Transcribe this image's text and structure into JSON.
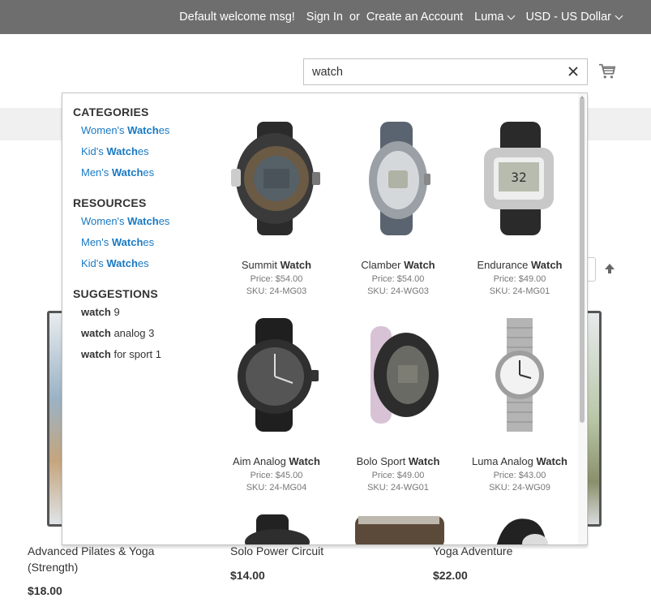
{
  "topbar": {
    "welcome": "Default welcome msg!",
    "sign_in": "Sign In",
    "or": "or",
    "create_account": "Create an Account",
    "store": "Luma",
    "currency": "USD - US Dollar"
  },
  "search": {
    "value": "watch"
  },
  "autocomplete": {
    "categories_title": "CATEGORIES",
    "categories": [
      {
        "prefix": "Women's ",
        "match": "Watch",
        "suffix": "es"
      },
      {
        "prefix": "Kid's ",
        "match": "Watch",
        "suffix": "es"
      },
      {
        "prefix": "Men's ",
        "match": "Watch",
        "suffix": "es"
      }
    ],
    "resources_title": "RESOURCES",
    "resources": [
      {
        "prefix": "Women's ",
        "match": "Watch",
        "suffix": "es"
      },
      {
        "prefix": "Men's ",
        "match": "Watch",
        "suffix": "es"
      },
      {
        "prefix": "Kid's ",
        "match": "Watch",
        "suffix": "es"
      }
    ],
    "suggestions_title": "SUGGESTIONS",
    "suggestions": [
      {
        "match": "watch",
        "rest": " 9"
      },
      {
        "match": "watch",
        "rest": " analog 3"
      },
      {
        "match": "watch",
        "rest": " for sport 1"
      }
    ],
    "products": [
      {
        "name": "Summit ",
        "match": "Watch",
        "price": "Price: $54.00",
        "sku": "SKU: 24-MG03"
      },
      {
        "name": "Clamber ",
        "match": "Watch",
        "price": "Price: $54.00",
        "sku": "SKU: 24-WG03"
      },
      {
        "name": "Endurance ",
        "match": "Watch",
        "price": "Price: $49.00",
        "sku": "SKU: 24-MG01"
      },
      {
        "name": "Aim Analog ",
        "match": "Watch",
        "price": "Price: $45.00",
        "sku": "SKU: 24-MG04"
      },
      {
        "name": "Bolo Sport ",
        "match": "Watch",
        "price": "Price: $49.00",
        "sku": "SKU: 24-WG01"
      },
      {
        "name": "Luma Analog ",
        "match": "Watch",
        "price": "Price: $43.00",
        "sku": "SKU: 24-WG09"
      }
    ]
  },
  "background_products": [
    {
      "name_line1": "Advanced Pilates & Yoga",
      "name_line2": "(Strength)",
      "price": "$18.00"
    },
    {
      "name_line1": "Solo Power Circuit",
      "name_line2": "",
      "price": "$14.00"
    },
    {
      "name_line1": "Yoga Adventure",
      "name_line2": "",
      "price": "$22.00"
    }
  ],
  "colors": {
    "topbar": "#6e6e6e",
    "link": "#1979c3",
    "nav_band": "#f0f0f0"
  },
  "icons": [
    "chevron-down-icon",
    "close-icon",
    "cart-icon",
    "arrow-up-icon"
  ]
}
